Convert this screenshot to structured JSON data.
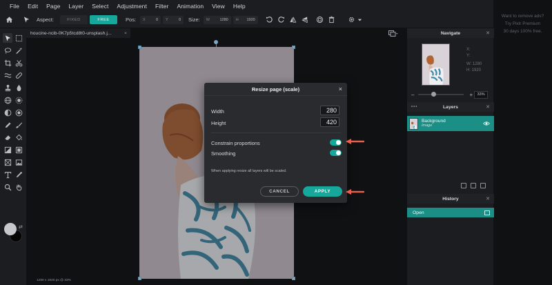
{
  "menu": [
    "File",
    "Edit",
    "Page",
    "Layer",
    "Select",
    "Adjustment",
    "Filter",
    "Animation",
    "View",
    "Help"
  ],
  "toolbar": {
    "aspect_label": "Aspect:",
    "fixed_label": "FIXED",
    "free_label": "FREE",
    "pos_label": "Pos:",
    "pos_x_prefix": "X",
    "pos_x": "0",
    "pos_y_prefix": "Y",
    "pos_y": "0",
    "size_label": "Size:",
    "size_w_prefix": "W",
    "size_w": "1280",
    "size_h_prefix": "H",
    "size_h": "1920"
  },
  "ad": {
    "line1": "Want to remove ads?",
    "line2": "Try Pixlr Premium",
    "line3": "30 days 100% free."
  },
  "document": {
    "tab_name": "houcine-ncib-0K7p5tcd8t0-unsplash.j...",
    "tab_close": "×",
    "status": "1280 x 1920 px @ 33%"
  },
  "navigate": {
    "title": "Navigate",
    "x_label": "X:",
    "y_label": "Y:",
    "w_label": "W:",
    "w_value": "1280",
    "h_label": "H:",
    "h_value": "1920",
    "zoom_minus": "–",
    "zoom_plus": "+",
    "zoom_value": "33%",
    "zoom_fraction": 0.33
  },
  "layers": {
    "title": "Layers",
    "items": [
      {
        "name": "Background",
        "type": "Image"
      }
    ]
  },
  "history": {
    "title": "History",
    "items": [
      "Open"
    ]
  },
  "dialog": {
    "title": "Resize page (scale)",
    "close": "×",
    "width_label": "Width",
    "width_value": "280",
    "height_label": "Height",
    "height_value": "420",
    "constrain_label": "Constrain proportions",
    "constrain_on": true,
    "smoothing_label": "Smoothing",
    "smoothing_on": true,
    "note": "When applying resize all layers will be scaled.",
    "cancel_label": "CANCEL",
    "apply_label": "APPLY"
  },
  "colors": {
    "accent": "#16a89b",
    "panel": "#1c1d20",
    "canvas_bg": "#101113",
    "annotation_arrow": "#e8604c",
    "primary_swatch": "#c6c8cc",
    "secondary_swatch": "#050506"
  }
}
